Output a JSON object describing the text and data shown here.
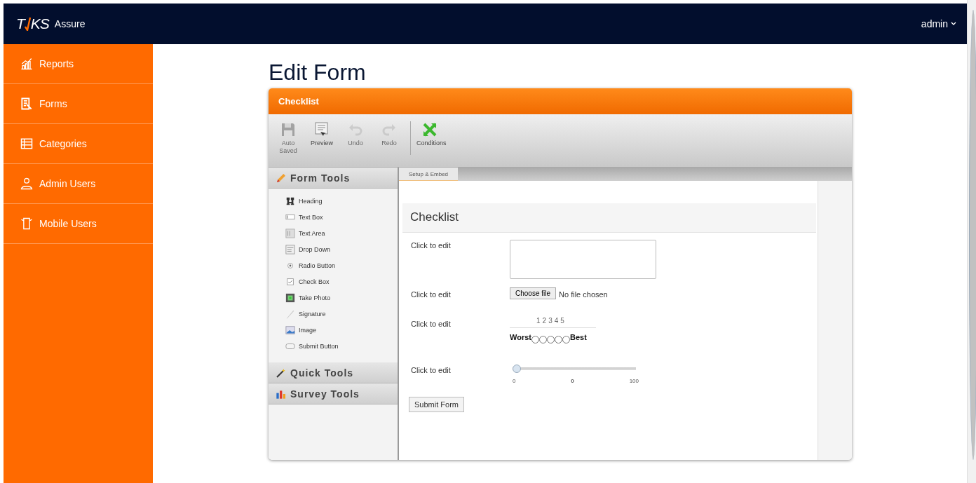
{
  "topbar": {
    "logo": {
      "left": "T",
      "right": "KS"
    },
    "product": "Assure",
    "user_menu": "admin"
  },
  "sidebar": {
    "items": [
      {
        "label": "Reports",
        "selected": false
      },
      {
        "label": "Forms",
        "selected": false
      },
      {
        "label": "Categories",
        "selected": false
      },
      {
        "label": "Admin Users",
        "selected": false
      },
      {
        "label": "Mobile Users",
        "selected": false
      }
    ]
  },
  "page_title": "Edit Form",
  "panel": {
    "title": "Checklist",
    "toolbar": [
      {
        "label": "Auto Saved",
        "disabled": true
      },
      {
        "label": "Preview",
        "disabled": false
      },
      {
        "label": "Undo",
        "disabled": true
      },
      {
        "label": "Redo",
        "disabled": true
      },
      {
        "label": "Conditions",
        "disabled": false
      }
    ],
    "tool_sections": [
      {
        "title": "Form Tools",
        "tools": [
          {
            "label": "Heading"
          },
          {
            "label": "Text Box"
          },
          {
            "label": "Text Area"
          },
          {
            "label": "Drop Down"
          },
          {
            "label": "Radio Button"
          },
          {
            "label": "Check Box"
          },
          {
            "label": "Take Photo"
          },
          {
            "label": "Signature"
          },
          {
            "label": "Image"
          },
          {
            "label": "Submit Button"
          }
        ]
      },
      {
        "title": "Quick Tools"
      },
      {
        "title": "Survey Tools"
      }
    ],
    "tabs": [
      {
        "label": "Setup & Embed",
        "selected": true
      }
    ],
    "form": {
      "heading": "Checklist",
      "fields": [
        {
          "kind": "textarea",
          "label": "Click to edit"
        },
        {
          "kind": "file",
          "label": "Click to edit",
          "button": "Choose file",
          "status": "No file chosen"
        },
        {
          "kind": "rating",
          "label": "Click to edit",
          "numbers": [
            "1",
            "2",
            "3",
            "4",
            "5"
          ],
          "low": "Worst",
          "high": "Best",
          "options": [
            {
              "selected": false
            },
            {
              "selected": false
            },
            {
              "selected": false
            },
            {
              "selected": false
            },
            {
              "selected": false
            }
          ]
        },
        {
          "kind": "slider",
          "label": "Click to edit",
          "level": 0,
          "min": "0",
          "value": "0",
          "max": "100"
        }
      ],
      "submit": "Submit Form"
    }
  }
}
